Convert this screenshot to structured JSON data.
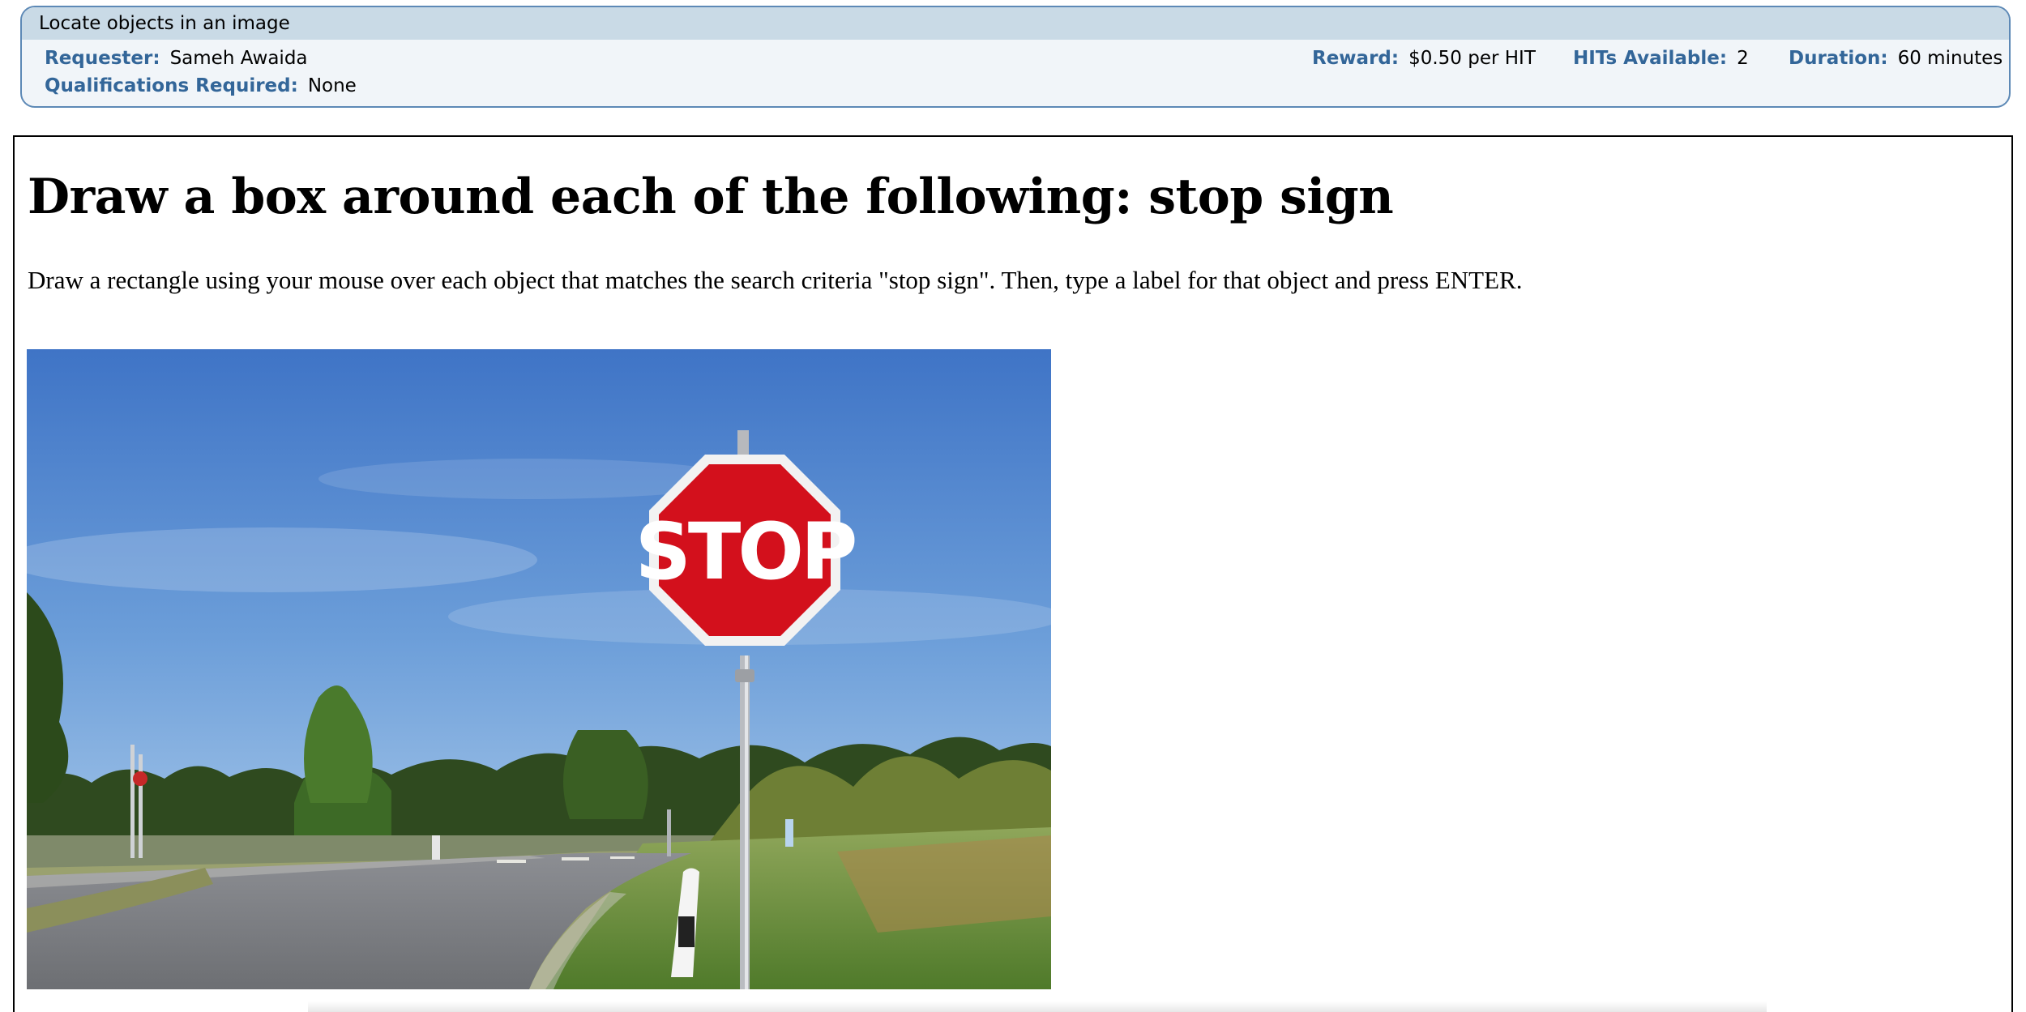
{
  "hit": {
    "title": "Locate objects in an image",
    "requester_label": "Requester:",
    "requester_value": "Sameh Awaida",
    "qualifications_label": "Qualifications Required:",
    "qualifications_value": "None",
    "reward_label": "Reward:",
    "reward_value": "$0.50 per HIT",
    "hits_available_label": "HITs Available:",
    "hits_available_value": "2",
    "duration_label": "Duration:",
    "duration_value": "60 minutes"
  },
  "task": {
    "heading": "Draw a box around each of the following: stop sign",
    "instructions": "Draw a rectangle using your mouse over each object that matches the search criteria \"stop sign\". Then, type a label for that object and press ENTER.",
    "image_sign_text": "STOP"
  },
  "colors": {
    "panel_border": "#5d89b6",
    "panel_title_bar": "#c9dae6",
    "panel_background": "#f1f5f9",
    "label_blue": "#336699",
    "stop_red": "#d3101c"
  }
}
